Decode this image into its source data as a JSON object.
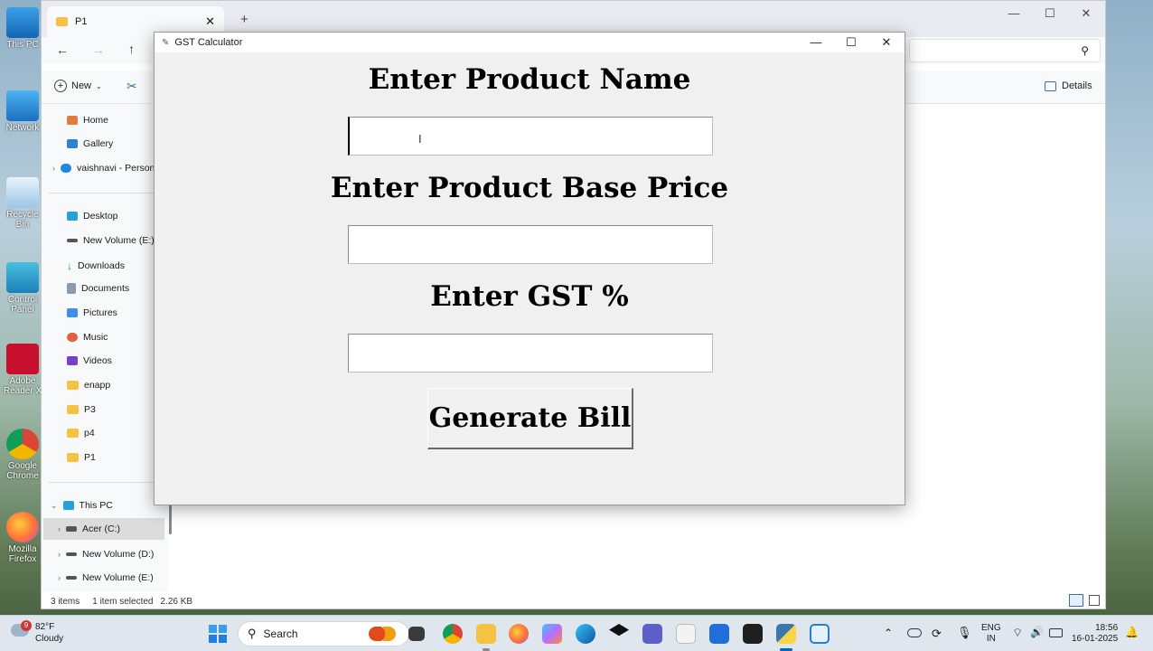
{
  "desktop": {
    "icons": [
      {
        "label": "This PC"
      },
      {
        "label": "Network"
      },
      {
        "label": "Recycle Bin"
      },
      {
        "label": "Control Panel"
      },
      {
        "label": "Adobe Reader X"
      },
      {
        "label": "Google Chrome"
      },
      {
        "label": "Mozilla Firefox"
      }
    ]
  },
  "explorer": {
    "tab_title": "P1",
    "new_tab": "+",
    "new_label": "New",
    "details_label": "Details",
    "nav": {
      "home": "Home",
      "gallery": "Gallery",
      "onedrive": "vaishnavi - Persona",
      "desktop": "Desktop",
      "new_volume_e": "New Volume (E:)",
      "downloads": "Downloads",
      "documents": "Documents",
      "pictures": "Pictures",
      "music": "Music",
      "videos": "Videos",
      "enapp": "enapp",
      "p3": "P3",
      "p4": "p4",
      "p1": "P1",
      "this_pc": "This PC",
      "acer_c": "Acer (C:)",
      "new_volume_d": "New Volume (D:)",
      "new_volume_e2": "New Volume (E:)"
    },
    "status": {
      "items": "3 items",
      "selected": "1 item selected",
      "size": "2.26 KB"
    }
  },
  "gst_app": {
    "window_title": "GST Calculator",
    "product_name_label": "Enter Product Name",
    "product_name_value": "",
    "base_price_label": "Enter Product Base Price",
    "base_price_value": "",
    "gst_label": "Enter GST %",
    "gst_value": "",
    "generate_button": "Generate Bill"
  },
  "taskbar": {
    "weather_temp": "82°F",
    "weather_desc": "Cloudy",
    "weather_badge": "9",
    "search_label": "Search",
    "lang_line1": "ENG",
    "lang_line2": "IN",
    "time": "18:56",
    "date": "16-01-2025"
  },
  "colors": {
    "accent": "#0067c0",
    "folder": "#f5c242",
    "dialog_bg": "#f0f0f0"
  }
}
